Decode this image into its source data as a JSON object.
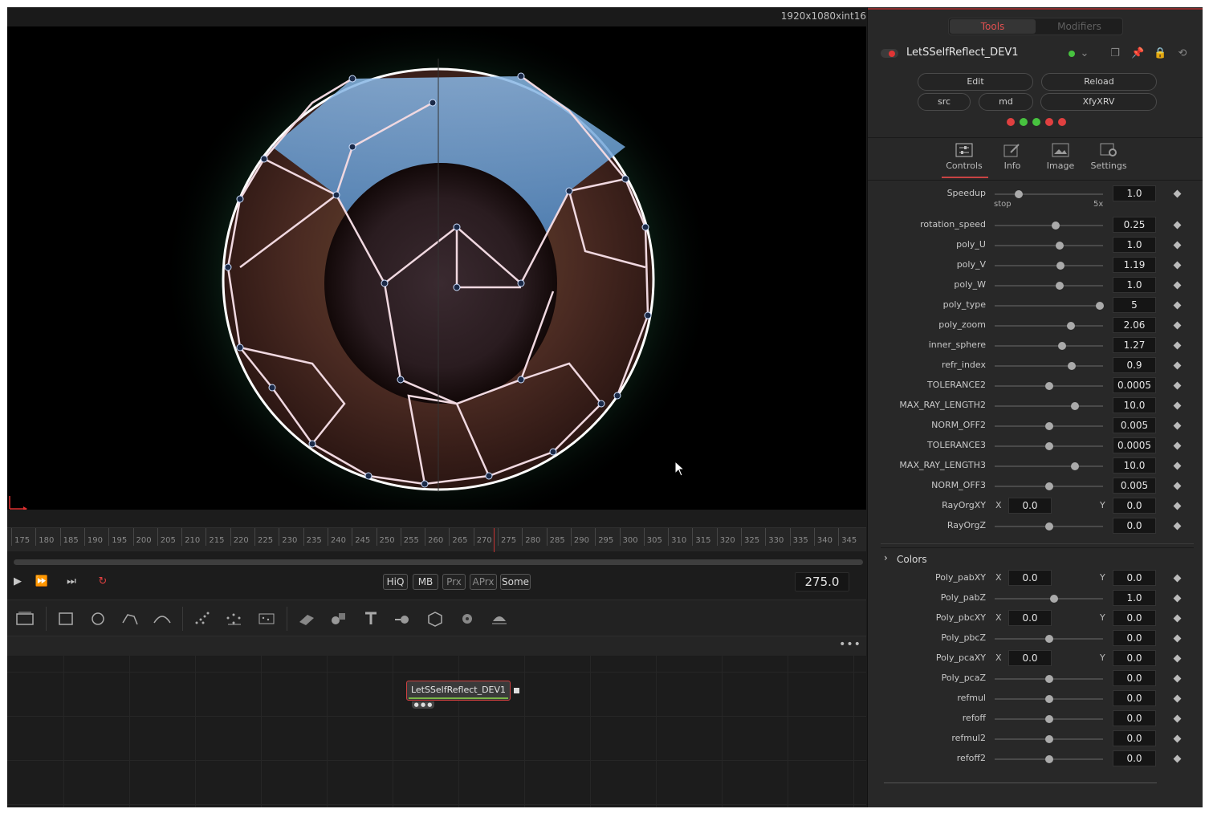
{
  "viewer": {
    "resolution": "1920x1080xint16"
  },
  "timeline": {
    "ticks": [
      "175",
      "180",
      "185",
      "190",
      "195",
      "200",
      "205",
      "210",
      "215",
      "220",
      "225",
      "230",
      "235",
      "240",
      "245",
      "250",
      "255",
      "260",
      "265",
      "270",
      "275",
      "280",
      "285",
      "290",
      "295",
      "300",
      "305",
      "310",
      "315",
      "320",
      "325",
      "330",
      "335",
      "340",
      "345"
    ]
  },
  "transport": {
    "hiq": "HiQ",
    "mb": "MB",
    "prx": "Prx",
    "aprx": "APrx",
    "some": "Some",
    "current_frame": "275.0"
  },
  "node_editor": {
    "node_label": "LetSSelfReflect_DEV1",
    "more": "•••"
  },
  "inspector": {
    "tabs": {
      "tools": "Tools",
      "modifiers": "Modifiers"
    },
    "tool_name": "LetSSelfReflect_DEV1",
    "buttons": {
      "edit": "Edit",
      "reload": "Reload",
      "src": "src",
      "md": "md",
      "xfyxrv": "XfyXRV"
    },
    "status_dots": [
      "#e04040",
      "#47c23f",
      "#47c23f",
      "#e04040",
      "#e04040"
    ],
    "control_tabs": [
      {
        "label": "Controls",
        "icon": "sliders-icon"
      },
      {
        "label": "Info",
        "icon": "edit-icon"
      },
      {
        "label": "Image",
        "icon": "image-icon"
      },
      {
        "label": "Settings",
        "icon": "settings-icon"
      }
    ],
    "speedup": {
      "label": "Speedup",
      "value": "1.0",
      "min_label": "stop",
      "max_label": "5x",
      "level": 0.22
    },
    "controls": [
      {
        "label": "rotation_speed",
        "value": "0.25",
        "level": 0.56
      },
      {
        "label": "poly_U",
        "value": "1.0",
        "level": 0.6
      },
      {
        "label": "poly_V",
        "value": "1.19",
        "level": 0.61
      },
      {
        "label": "poly_W",
        "value": "1.0",
        "level": 0.6
      },
      {
        "label": "poly_type",
        "value": "5",
        "level": 0.97
      },
      {
        "label": "poly_zoom",
        "value": "2.06",
        "level": 0.7
      },
      {
        "label": "inner_sphere",
        "value": "1.27",
        "level": 0.62
      },
      {
        "label": "refr_index",
        "value": "0.9",
        "level": 0.71
      },
      {
        "label": "TOLERANCE2",
        "value": "0.0005",
        "level": 0.5
      },
      {
        "label": "MAX_RAY_LENGTH2",
        "value": "10.0",
        "level": 0.74
      },
      {
        "label": "NORM_OFF2",
        "value": "0.005",
        "level": 0.5
      },
      {
        "label": "TOLERANCE3",
        "value": "0.0005",
        "level": 0.5
      },
      {
        "label": "MAX_RAY_LENGTH3",
        "value": "10.0",
        "level": 0.74
      },
      {
        "label": "NORM_OFF3",
        "value": "0.005",
        "level": 0.5
      }
    ],
    "ray_org_xy": {
      "label": "RayOrgXY",
      "x_label": "X",
      "x": "0.0",
      "y_label": "Y",
      "y": "0.0"
    },
    "ray_org_z": {
      "label": "RayOrgZ",
      "value": "0.0",
      "level": 0.5
    },
    "colors_section": "Colors",
    "color_controls": [
      {
        "label": "Poly_pabXY",
        "type": "xy",
        "x_label": "X",
        "x": "0.0",
        "y_label": "Y",
        "y": "0.0"
      },
      {
        "label": "Poly_pabZ",
        "type": "slider",
        "value": "1.0",
        "level": 0.55
      },
      {
        "label": "Poly_pbcXY",
        "type": "xy",
        "x_label": "X",
        "x": "0.0",
        "y_label": "Y",
        "y": "0.0"
      },
      {
        "label": "Poly_pbcZ",
        "type": "slider",
        "value": "0.0",
        "level": 0.5
      },
      {
        "label": "Poly_pcaXY",
        "type": "xy",
        "x_label": "X",
        "x": "0.0",
        "y_label": "Y",
        "y": "0.0"
      },
      {
        "label": "Poly_pcaZ",
        "type": "slider",
        "value": "0.0",
        "level": 0.5
      },
      {
        "label": "refmul",
        "type": "slider",
        "value": "0.0",
        "level": 0.5
      },
      {
        "label": "refoff",
        "type": "slider",
        "value": "0.0",
        "level": 0.5
      },
      {
        "label": "refmul2",
        "type": "slider",
        "value": "0.0",
        "level": 0.5
      },
      {
        "label": "refoff2",
        "type": "slider",
        "value": "0.0",
        "level": 0.5
      }
    ]
  }
}
